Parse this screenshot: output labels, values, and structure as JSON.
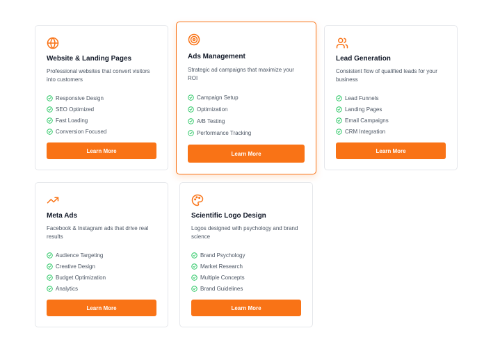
{
  "header": {
    "cut_text": "customers"
  },
  "accent_color": "#f97316",
  "cards": [
    {
      "icon": "globe-icon",
      "title": "Website & Landing Pages",
      "description": "Professional websites that convert visitors into customers",
      "features": [
        "Responsive Design",
        "SEO Optimized",
        "Fast Loading",
        "Conversion Focused"
      ],
      "button": "Learn More"
    },
    {
      "icon": "target-icon",
      "title": "Ads Management",
      "description": "Strategic ad campaigns that maximize your ROI",
      "features": [
        "Campaign Setup",
        "Optimization",
        "A/B Testing",
        "Performance Tracking"
      ],
      "button": "Learn More",
      "featured": true
    },
    {
      "icon": "users-icon",
      "title": "Lead Generation",
      "description": "Consistent flow of qualified leads for your business",
      "features": [
        "Lead Funnels",
        "Landing Pages",
        "Email Campaigns",
        "CRM Integration"
      ],
      "button": "Learn More"
    },
    {
      "icon": "trending-up-icon",
      "title": "Meta Ads",
      "description": "Facebook & Instagram ads that drive real results",
      "features": [
        "Audience Targeting",
        "Creative Design",
        "Budget Optimization",
        "Analytics"
      ],
      "button": "Learn More"
    },
    {
      "icon": "palette-icon",
      "title": "Scientific Logo Design",
      "description": "Logos designed with psychology and brand science",
      "features": [
        "Brand Psychology",
        "Market Research",
        "Multiple Concepts",
        "Brand Guidelines"
      ],
      "button": "Learn More"
    }
  ]
}
